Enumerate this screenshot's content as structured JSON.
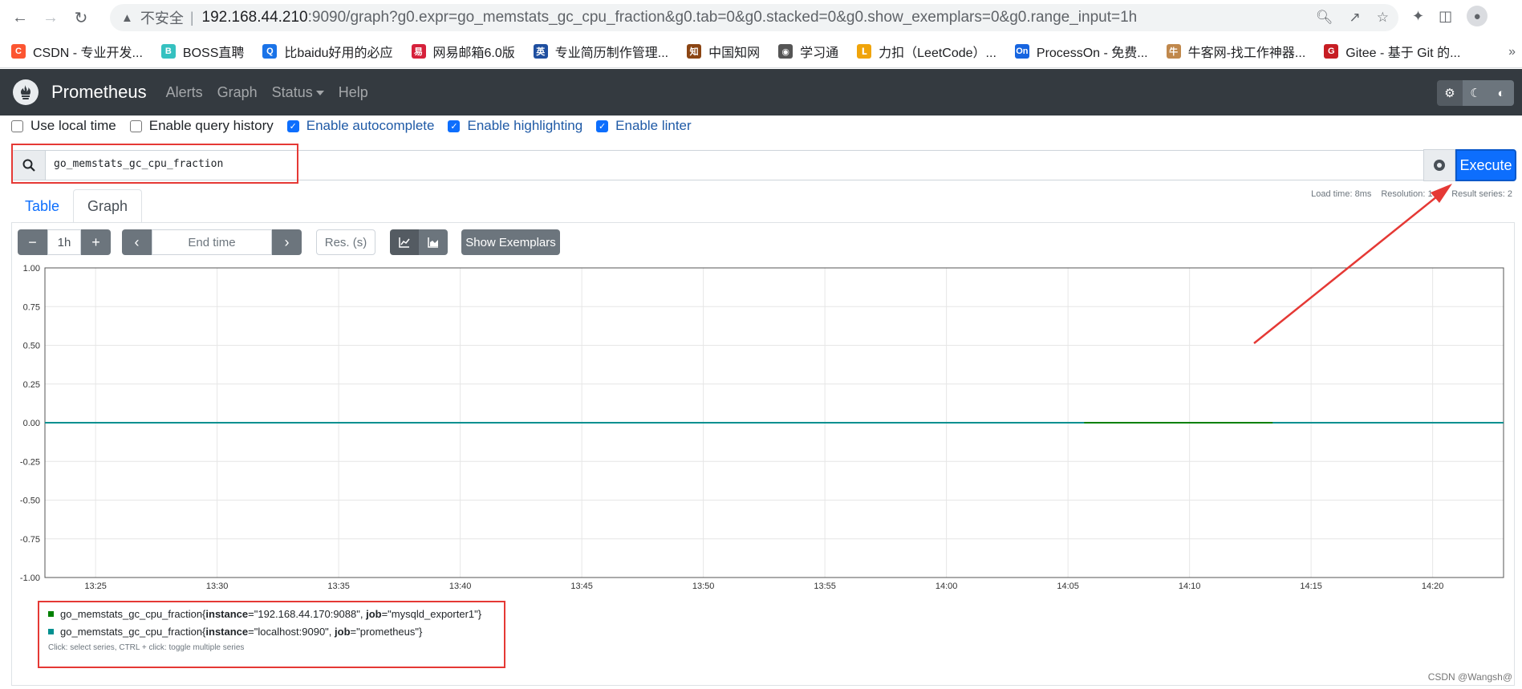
{
  "browser": {
    "insecure_label": "不安全",
    "url_host": "192.168.44.210",
    "url_rest": ":9090/graph?g0.expr=go_memstats_gc_cpu_fraction&g0.tab=0&g0.stacked=0&g0.show_exemplars=0&g0.range_input=1h"
  },
  "bookmarks": [
    {
      "label": "CSDN - 专业开发...",
      "icon_text": "C",
      "color": "#fc5531"
    },
    {
      "label": "BOSS直聘",
      "icon_text": "B",
      "color": "#35c1c0"
    },
    {
      "label": "比baidu好用的必应",
      "icon_text": "Q",
      "color": "#1a73e8"
    },
    {
      "label": "网易邮箱6.0版",
      "icon_text": "易",
      "color": "#d6213b"
    },
    {
      "label": "专业简历制作管理...",
      "icon_text": "英",
      "color": "#1f4fa0"
    },
    {
      "label": "中国知网",
      "icon_text": "知",
      "color": "#8b4513"
    },
    {
      "label": "学习通",
      "icon_text": "◉",
      "color": "#555555"
    },
    {
      "label": "力扣（LeetCode）...",
      "icon_text": "ᒪ",
      "color": "#f0a40a"
    },
    {
      "label": "ProcessOn - 免费...",
      "icon_text": "On",
      "color": "#1765e0"
    },
    {
      "label": "牛客网-找工作神器...",
      "icon_text": "牛",
      "color": "#c0884c"
    },
    {
      "label": "Gitee - 基于 Git 的...",
      "icon_text": "G",
      "color": "#c71d23"
    }
  ],
  "navbar": {
    "brand": "Prometheus",
    "links": [
      "Alerts",
      "Graph",
      "Status",
      "Help"
    ]
  },
  "options": [
    {
      "label": "Use local time",
      "checked": false
    },
    {
      "label": "Enable query history",
      "checked": false
    },
    {
      "label": "Enable autocomplete",
      "checked": true
    },
    {
      "label": "Enable highlighting",
      "checked": true
    },
    {
      "label": "Enable linter",
      "checked": true
    }
  ],
  "query": {
    "expression": "go_memstats_gc_cpu_fraction",
    "execute_label": "Execute"
  },
  "stats": {
    "load_time": "Load time: 8ms",
    "resolution": "Resolution: 14s",
    "result_series": "Result series: 2"
  },
  "tabs": {
    "table": "Table",
    "graph": "Graph"
  },
  "graph_controls": {
    "range": "1h",
    "end_time_placeholder": "End time",
    "resolution_placeholder": "Res. (s)",
    "exemplars_label": "Show Exemplars"
  },
  "chart_data": {
    "type": "line",
    "ylim": [
      -1.0,
      1.0
    ],
    "yticks": [
      1.0,
      0.75,
      0.5,
      0.25,
      0.0,
      -0.25,
      -0.5,
      -0.75,
      -1.0
    ],
    "ytick_labels": [
      "1.00",
      "0.75",
      "0.50",
      "0.25",
      "0.00",
      "-0.25",
      "-0.50",
      "-0.75",
      "-1.00"
    ],
    "xlim": [
      "13:22:55",
      "14:22:55"
    ],
    "xticks": [
      "13:25",
      "13:30",
      "13:35",
      "13:40",
      "13:45",
      "13:50",
      "13:55",
      "14:00",
      "14:05",
      "14:10",
      "14:15",
      "14:20"
    ],
    "grid": true,
    "series": [
      {
        "color": "#008000",
        "segments": [
          {
            "x": [
              "13:22:55",
              "14:22:55"
            ],
            "y": [
              0.0,
              0.0
            ]
          }
        ]
      },
      {
        "color": "#009090",
        "segments": [
          {
            "x": [
              "13:22:55",
              "14:05:40"
            ],
            "y": [
              0.0,
              0.0
            ]
          },
          {
            "x": [
              "14:13:25",
              "14:22:55"
            ],
            "y": [
              0.0,
              0.0
            ]
          }
        ]
      }
    ]
  },
  "legend": {
    "items": [
      {
        "metric": "go_memstats_gc_cpu_fraction",
        "instance": "192.168.44.170:9088",
        "job": "mysqld_exporter1",
        "color": "#008000"
      },
      {
        "metric": "go_memstats_gc_cpu_fraction",
        "instance": "localhost:9090",
        "job": "prometheus",
        "color": "#009090"
      }
    ],
    "hint": "Click: select series, CTRL + click: toggle multiple series"
  },
  "watermark": "CSDN @Wangsh@"
}
